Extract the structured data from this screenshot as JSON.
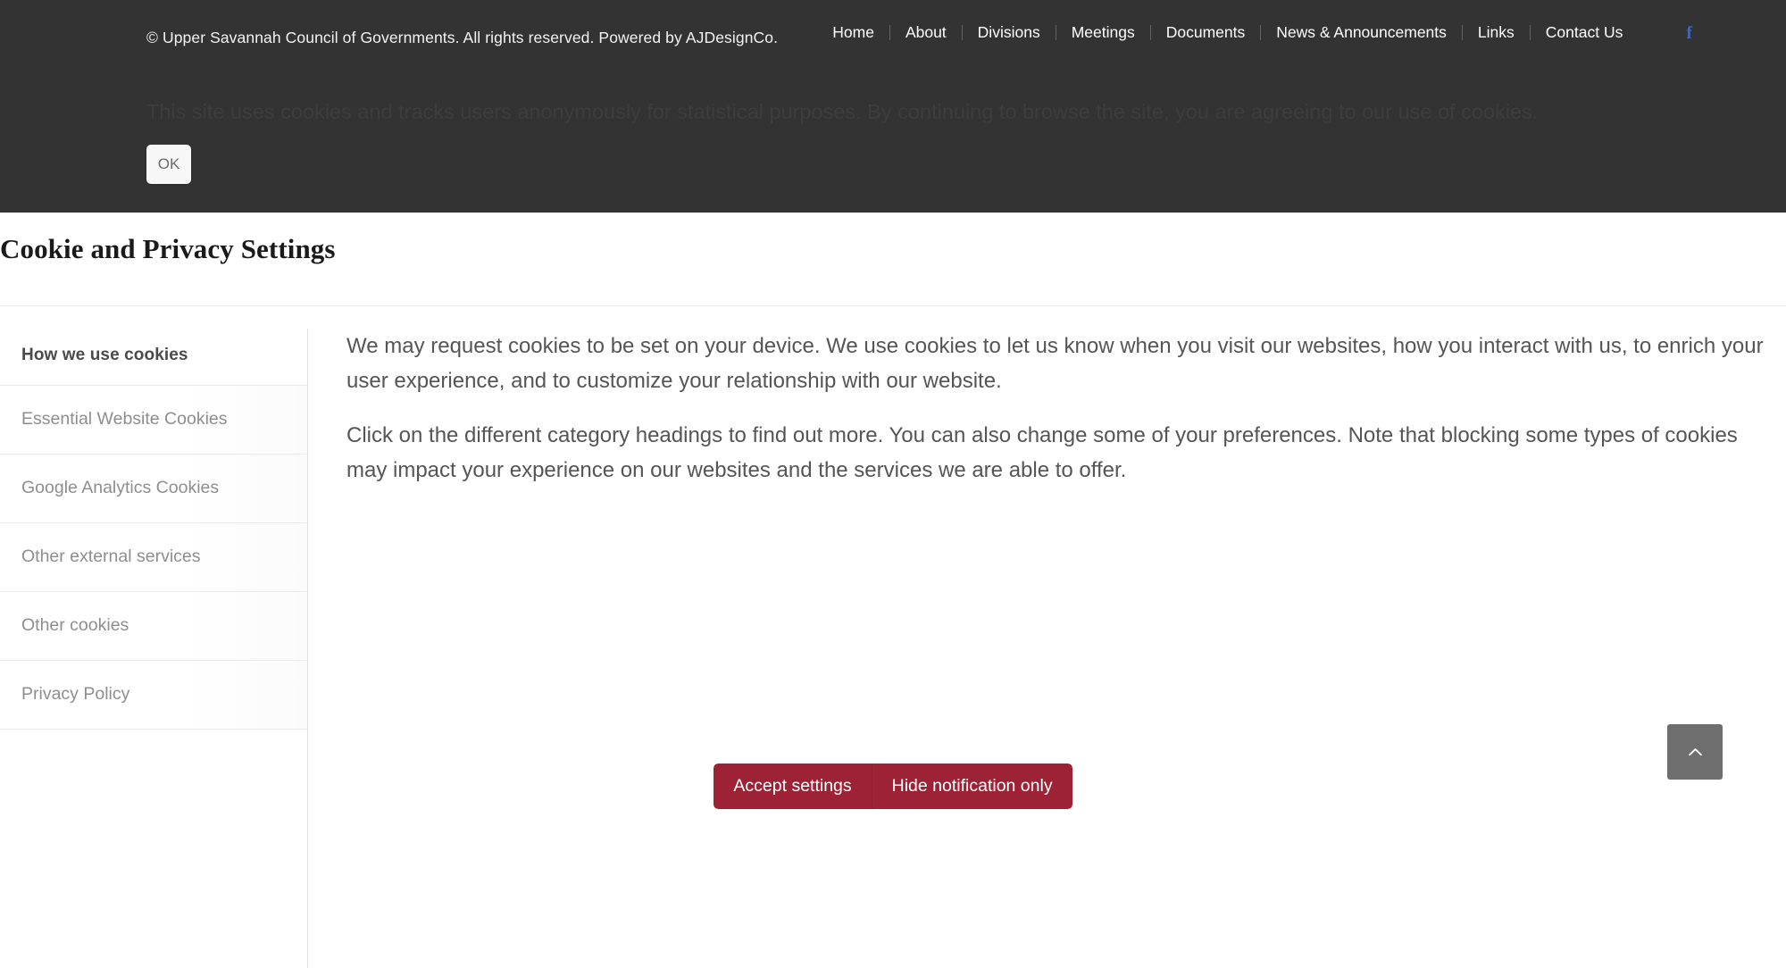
{
  "header": {
    "copyright": "© Upper Savannah Council of Governments. All rights reserved. Powered by AJDesignCo.",
    "nav_items": [
      {
        "label": "Home"
      },
      {
        "label": "About"
      },
      {
        "label": "Divisions"
      },
      {
        "label": "Meetings"
      },
      {
        "label": "Documents"
      },
      {
        "label": "News & Announcements"
      },
      {
        "label": "Links"
      },
      {
        "label": "Contact Us"
      }
    ],
    "social": {
      "facebook_glyph": "f",
      "facebook_color": "#4267b2"
    },
    "background_color": "#333333"
  },
  "cookie_notice": {
    "text": "This site uses cookies and tracks users anonymously for statistical purposes. By continuing to browse the site, you are agreeing to our use of cookies.",
    "ok_label": "OK"
  },
  "modal": {
    "title": "Cookie and Privacy Settings",
    "sidebar": {
      "heading": "How we use cookies",
      "items": [
        {
          "label": "Essential Website Cookies"
        },
        {
          "label": "Google Analytics Cookies"
        },
        {
          "label": "Other external services"
        },
        {
          "label": "Other cookies"
        },
        {
          "label": "Privacy Policy"
        }
      ]
    },
    "content": {
      "paragraphs": [
        "We may request cookies to be set on your device. We use cookies to let us know when you visit our websites, how you interact with us, to enrich your user experience, and to customize your relationship with our website.",
        "Click on the different category headings to find out more. You can also change some of your preferences. Note that blocking some types of cookies may impact your experience on our websites and the services we are able to offer."
      ]
    },
    "actions": {
      "accept_label": "Accept settings",
      "hide_label": "Hide notification only",
      "button_color": "#9d2235"
    }
  },
  "scroll_to_top": {
    "icon": "chevron-up-icon",
    "background_color": "#6e6e6e"
  }
}
